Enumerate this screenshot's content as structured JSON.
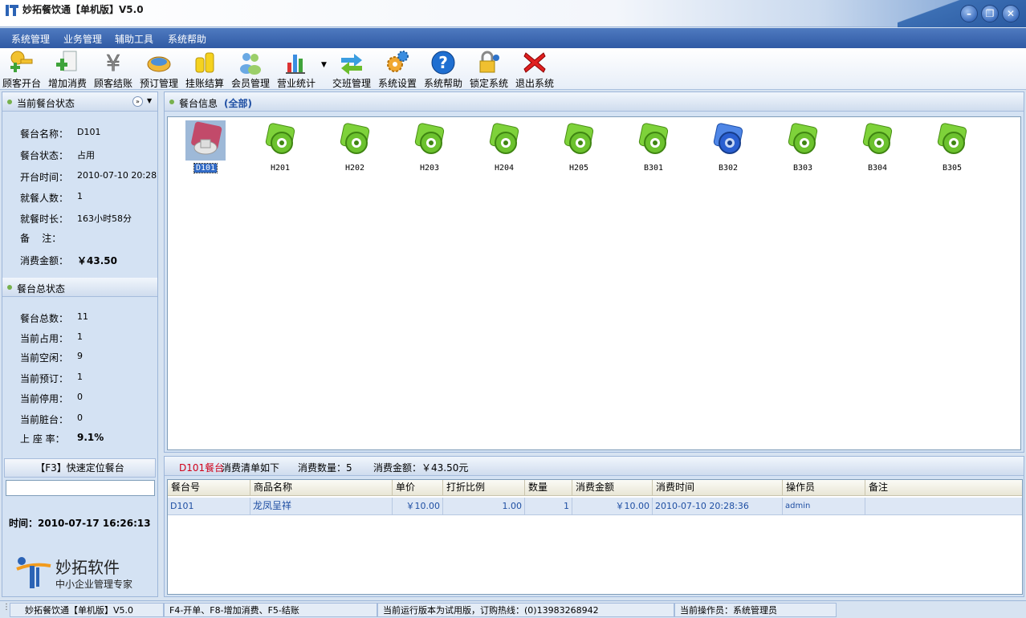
{
  "window": {
    "title": "妙拓餐饮通【单机版】V5.0",
    "minimize": "–",
    "restore": "❐",
    "close": "✕"
  },
  "menu": [
    "系统管理",
    "业务管理",
    "辅助工具",
    "系统帮助"
  ],
  "toolbar": [
    {
      "label": "顾客开台",
      "icon": "key-add-icon"
    },
    {
      "label": "增加消费",
      "icon": "add-document-icon"
    },
    {
      "label": "顾客结账",
      "icon": "yen-icon"
    },
    {
      "label": "预订管理",
      "icon": "food-plate-icon"
    },
    {
      "label": "挂账结算",
      "icon": "coins-icon"
    },
    {
      "label": "会员管理",
      "icon": "users-icon"
    },
    {
      "label": "营业统计",
      "icon": "bar-chart-icon"
    },
    {
      "label": "交班管理",
      "icon": "swap-arrows-icon"
    },
    {
      "label": "系统设置",
      "icon": "gears-icon"
    },
    {
      "label": "系统帮助",
      "icon": "help-icon"
    },
    {
      "label": "锁定系统",
      "icon": "lock-key-icon"
    },
    {
      "label": "退出系统",
      "icon": "exit-x-icon"
    }
  ],
  "current_table": {
    "header": "当前餐台状态",
    "fields": [
      {
        "label": "餐台名称：",
        "value": "D101"
      },
      {
        "label": "餐台状态：",
        "value": "占用"
      },
      {
        "label": "开台时间：",
        "value": "2010-07-10 20:28"
      },
      {
        "label": "就餐人数：",
        "value": "1"
      },
      {
        "label": "就餐时长：",
        "value": "163小时58分"
      },
      {
        "label": "备    注：",
        "value": ""
      },
      {
        "label": "消费金额：",
        "value": "￥43.50"
      }
    ]
  },
  "summary": {
    "header": "餐台总状态",
    "fields": [
      {
        "label": "餐台总数：",
        "value": "11"
      },
      {
        "label": "当前占用：",
        "value": "1"
      },
      {
        "label": "当前空闲：",
        "value": "9"
      },
      {
        "label": "当前预订：",
        "value": "1"
      },
      {
        "label": "当前停用：",
        "value": "0"
      },
      {
        "label": "当前脏台：",
        "value": "0"
      },
      {
        "label": "上 座 率：",
        "value": "9.1%"
      }
    ]
  },
  "quick_locate": {
    "label": "【F3】快速定位餐台",
    "value": ""
  },
  "clock": "时间：2010-07-17 16:26:13",
  "logo": {
    "name": "妙拓软件",
    "slogan": "中小企业管理专家"
  },
  "tables_panel": {
    "title": "餐台信息",
    "filter": "(全部)"
  },
  "tables": [
    {
      "name": "D101",
      "status": "occupied"
    },
    {
      "name": "H201",
      "status": "free"
    },
    {
      "name": "H202",
      "status": "free"
    },
    {
      "name": "H203",
      "status": "free"
    },
    {
      "name": "H204",
      "status": "free"
    },
    {
      "name": "H205",
      "status": "free"
    },
    {
      "name": "B301",
      "status": "free"
    },
    {
      "name": "B302",
      "status": "reserved"
    },
    {
      "name": "B303",
      "status": "free"
    },
    {
      "name": "B304",
      "status": "free"
    },
    {
      "name": "B305",
      "status": "free"
    }
  ],
  "consumption": {
    "table": "D101餐台",
    "list_text": "消费清单如下",
    "count": "消费数量：5",
    "amount": "消费金额：￥43.50元",
    "columns": [
      "餐台号",
      "商品名称",
      "单价",
      "打折比例",
      "数量",
      "消费金额",
      "消费时间",
      "操作员",
      "备注"
    ],
    "rows": [
      [
        "D101",
        "龙凤呈祥",
        "￥10.00",
        "1.00",
        "1",
        "￥10.00",
        "2010-07-10 20:28:36",
        "admin",
        ""
      ]
    ]
  },
  "statusbar": {
    "app": "妙拓餐饮通【单机版】V5.0",
    "shortcuts": "F4-开单、F8-增加消费、F5-结账",
    "trial": "当前运行版本为试用版，订购热线：(0)13983268942",
    "operator": "当前操作员：系统管理员"
  },
  "colors": {
    "accent": "#2f5aa4",
    "free": "#6cc22e",
    "reserved": "#2a5fd1",
    "occupied": "#c24a6a",
    "link_text": "#1f4fa3",
    "alert": "#d0021b"
  }
}
